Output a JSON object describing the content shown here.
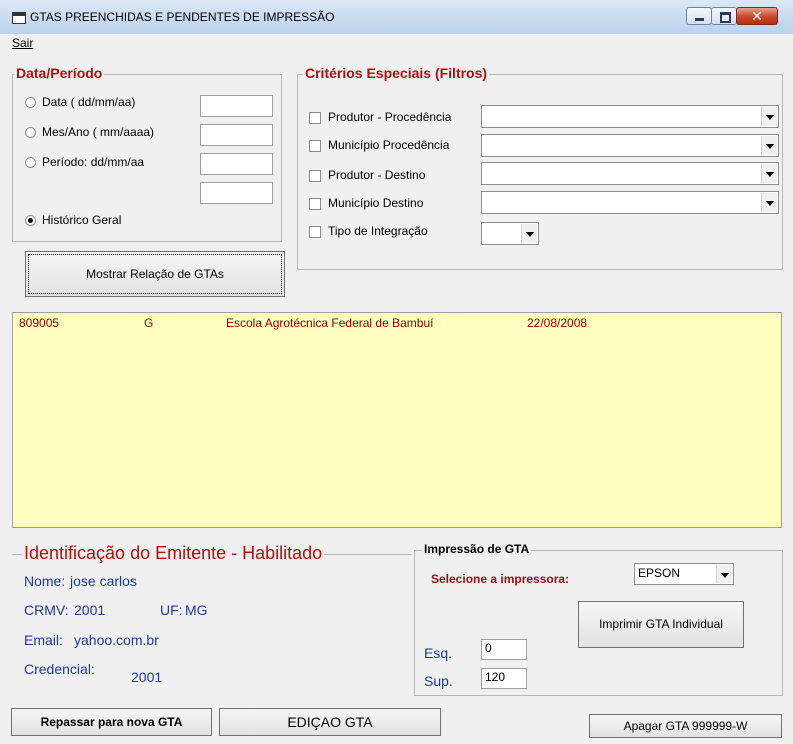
{
  "window": {
    "title": "GTAS PREENCHIDAS  E PENDENTES DE IMPRESSÃO",
    "close_glyph": "✕"
  },
  "menu": {
    "sair": "Sair"
  },
  "date_group": {
    "title": "Data/Período",
    "options": [
      {
        "label": "Data ( dd/mm/aa)",
        "checked": false
      },
      {
        "label": "Mes/Ano ( mm/aaaa)",
        "checked": false
      },
      {
        "label": "Período: dd/mm/aa",
        "checked": false
      },
      {
        "label": "Histórico Geral",
        "checked": true
      }
    ],
    "field_values": [
      "",
      "",
      "",
      ""
    ]
  },
  "filters_group": {
    "title": "Critérios Especiais (Filtros)",
    "items": [
      {
        "label": "Produtor - Procedência",
        "value": ""
      },
      {
        "label": "Município Procedência",
        "value": ""
      },
      {
        "label": "Produtor - Destino",
        "value": ""
      },
      {
        "label": "Município Destino",
        "value": ""
      },
      {
        "label": "Tipo de Integração",
        "value": ""
      }
    ]
  },
  "show_button": "Mostrar Relação de GTAs",
  "list": {
    "rows": [
      {
        "number": "809005",
        "type": "G",
        "name": "Escola Agrotécnica Federal de Bambuí",
        "date": "22/08/2008"
      }
    ]
  },
  "issuer": {
    "title": "Identificação do Emitente - Habilitado",
    "name_label": "Nome:",
    "name_value": "jose carlos",
    "crmv_label": "CRMV:",
    "crmv_value": "2001",
    "uf_label": "UF:",
    "uf_value": "MG",
    "email_label": "Email:",
    "email_value": "yahoo.com.br",
    "credencial_label": "Credencial:",
    "credencial_value": "2001"
  },
  "print_group": {
    "title": "Impressão de GTA",
    "select_label": "Selecione a impressora:",
    "printer_value": "EPSON",
    "print_button": "Imprimir GTA Individual",
    "esq_label": "Esq.",
    "esq_value": "0",
    "sup_label": "Sup.",
    "sup_value": "120"
  },
  "bottom": {
    "repassar": "Repassar para nova GTA",
    "edicao": "EDIÇAO GTA",
    "apagar": "Apagar GTA 999999-W"
  }
}
